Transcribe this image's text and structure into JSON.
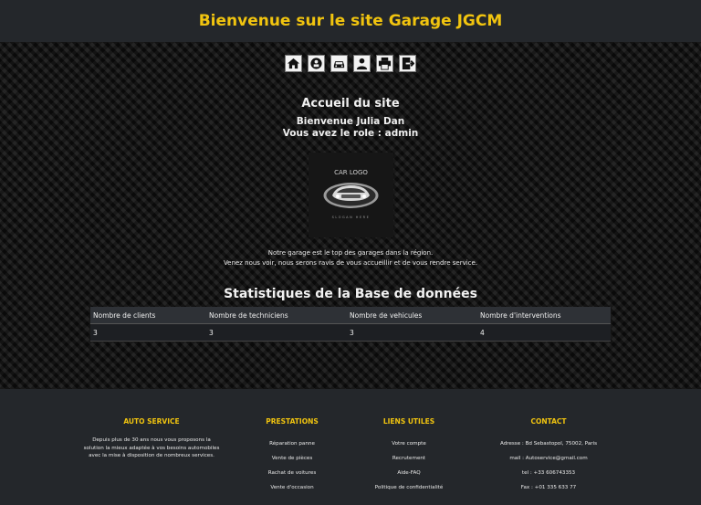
{
  "header": {
    "title": "Bienvenue sur le site Garage JGCM"
  },
  "nav": {
    "icons": [
      {
        "name": "home-icon"
      },
      {
        "name": "mechanic-icon"
      },
      {
        "name": "car-icon"
      },
      {
        "name": "user-icon"
      },
      {
        "name": "printer-icon"
      },
      {
        "name": "logout-icon"
      }
    ]
  },
  "welcome": {
    "title": "Accueil du site",
    "user": "Bienvenue Julia Dan",
    "role": "Vous avez le role : admin"
  },
  "logo": {
    "top_text": "CAR LOGO",
    "bottom_text": "SLOGAN HERE"
  },
  "intro": {
    "line1": "Notre garage est le top des garages dans la région.",
    "line2": "Venez nous voir, nous serons ravis de vous accueillir et de vous rendre service."
  },
  "stats": {
    "title": "Statistiques de la Base de données",
    "headers": [
      "Nombre de clients",
      "Nombre de techniciens",
      "Nombre de vehicules",
      "Nombre d'interventions"
    ],
    "row": [
      "3",
      "3",
      "3",
      "4"
    ]
  },
  "footer": {
    "auto": {
      "heading": "AUTO SERVICE",
      "lines": [
        "Depuis plus de 30 ans nous vous proposons la",
        "solution la mieux adaptée à vos besoins automobiles",
        "avec la mise à disposition de nombreux services."
      ]
    },
    "prestations": {
      "heading": "PRESTATIONS",
      "items": [
        "Réparation panne",
        "Vente de pièces",
        "Rachat de voitures",
        "Vente d'occasion"
      ]
    },
    "liens": {
      "heading": "LIENS UTILES",
      "items": [
        "Votre compte",
        "Recrutement",
        "Aide-FAQ",
        "Politique de confidentialité"
      ]
    },
    "contact": {
      "heading": "CONTACT",
      "items": [
        "Adresse : Bd Sebastopol, 75002, Paris",
        "mail : Autoservice@gmail.com",
        "tel : +33 606743353",
        "Fax : +01 335 633 77"
      ]
    }
  }
}
